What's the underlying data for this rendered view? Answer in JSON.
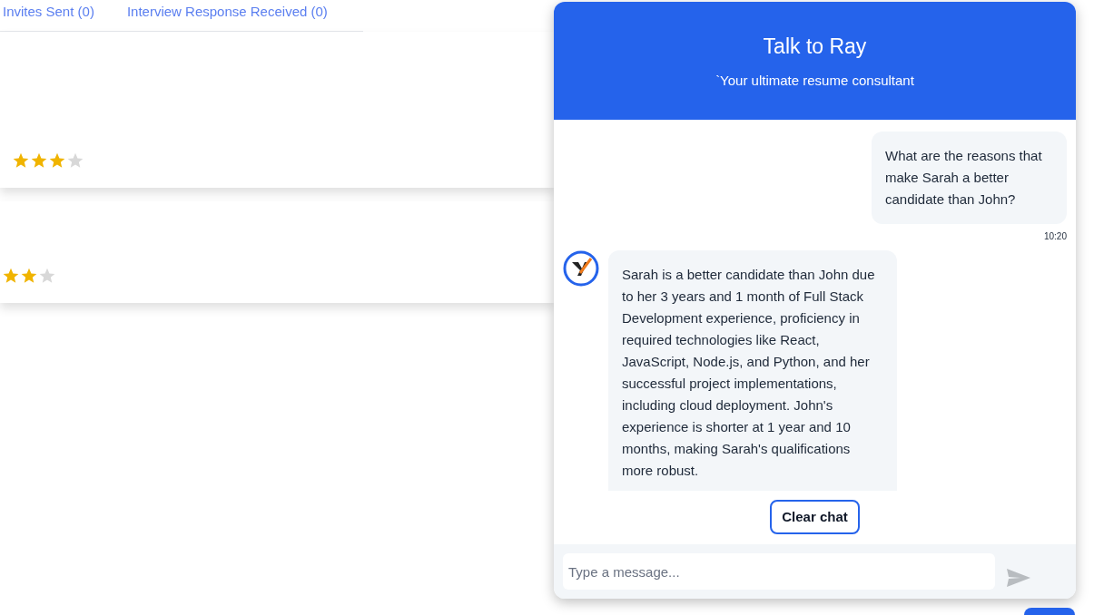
{
  "tabs": [
    {
      "label": "Invites Sent (0)",
      "selected": false
    },
    {
      "label": "Interview Response Received (0)",
      "selected": false
    }
  ],
  "cards": [
    {
      "stars": 3
    },
    {
      "stars": 2
    }
  ],
  "chat": {
    "title": "Talk to Ray",
    "subtitle": "`Your ultimate resume consultant",
    "messages": [
      {
        "kind": "user",
        "text": "What are the reasons that make Sarah a better candidate than John?",
        "time": "10:20"
      },
      {
        "kind": "bot",
        "text": "Sarah is a better candidate than John due to her 3 years and 1 month of Full Stack Development experience, proficiency in required technologies like React, JavaScript, Node.js, and Python, and her successful project implementations, including cloud deployment. John's experience is shorter at 1 year and 10 months, making Sarah's qualifications more robust."
      }
    ],
    "clear_button": "Clear chat",
    "input": {
      "placeholder": "Type a message..."
    }
  }
}
